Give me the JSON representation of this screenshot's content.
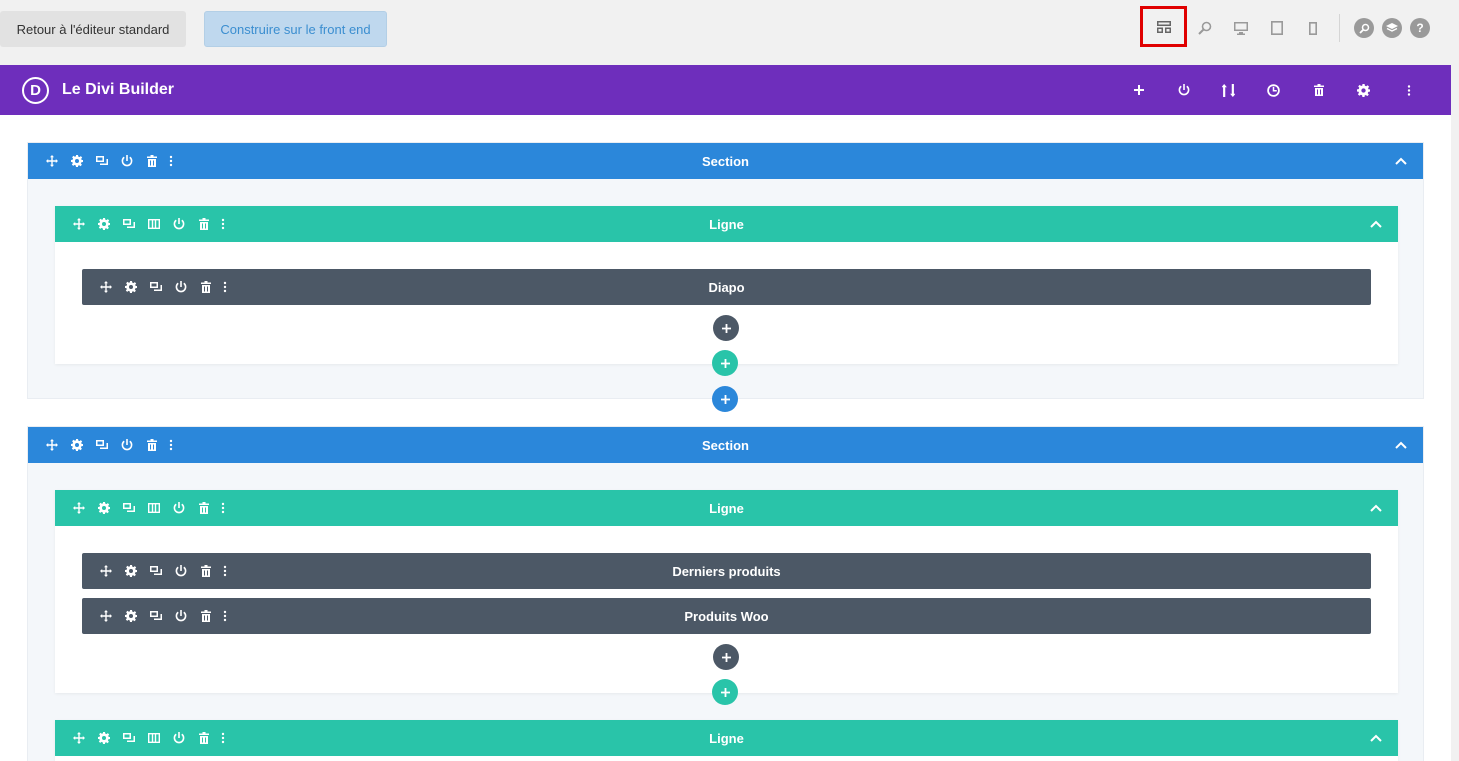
{
  "topbar": {
    "standard_editor_label": "Retour à l'éditeur standard",
    "frontend_label": "Construire sur le front end",
    "icons": [
      "layout-icon",
      "zoom-icon",
      "desktop-icon",
      "tablet-icon",
      "phone-icon",
      "search-icon",
      "layers-icon",
      "help-icon"
    ],
    "help_glyph": "?"
  },
  "builder": {
    "logo": "D",
    "title": "Le Divi Builder",
    "colors": {
      "header": "#6e2ebc",
      "section": "#2b87da",
      "row": "#29c4a9",
      "module": "#4c5866",
      "highlight": "#e00000"
    }
  },
  "sections": [
    {
      "label": "Section",
      "rows": [
        {
          "label": "Ligne",
          "modules": [
            {
              "label": "Diapo"
            }
          ]
        }
      ]
    },
    {
      "label": "Section",
      "rows": [
        {
          "label": "Ligne",
          "modules": [
            {
              "label": "Derniers produits"
            },
            {
              "label": "Produits Woo"
            }
          ]
        },
        {
          "label": "Ligne",
          "modules": []
        }
      ]
    }
  ]
}
